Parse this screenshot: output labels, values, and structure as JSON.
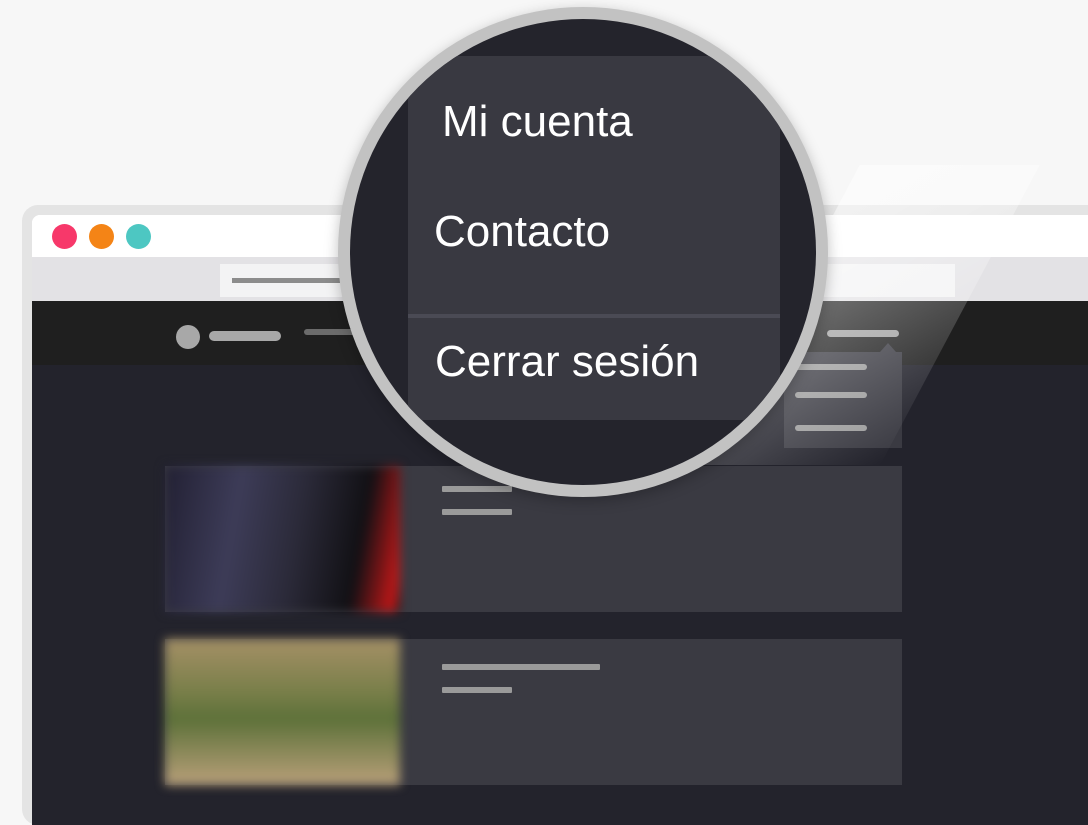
{
  "window": {
    "traffic_lights": {
      "close": "#f7386a",
      "minimize": "#f48416",
      "maximize": "#4dc7c2"
    }
  },
  "dropdown_menu": {
    "items": [
      {
        "label": "Mi cuenta",
        "icon": ""
      },
      {
        "label": "Contacto",
        "icon": ""
      },
      {
        "label": "Cerrar sesión",
        "icon": ""
      }
    ]
  },
  "colors": {
    "page_bg": "#23232c",
    "navbar_bg": "#1f1f1f",
    "card_bg": "#3a3a42",
    "menu_bg": "#393941",
    "menu_text": "#ffffff"
  },
  "icons": {
    "logo": "logo-circle-icon",
    "hamburger": "menu-icon"
  }
}
